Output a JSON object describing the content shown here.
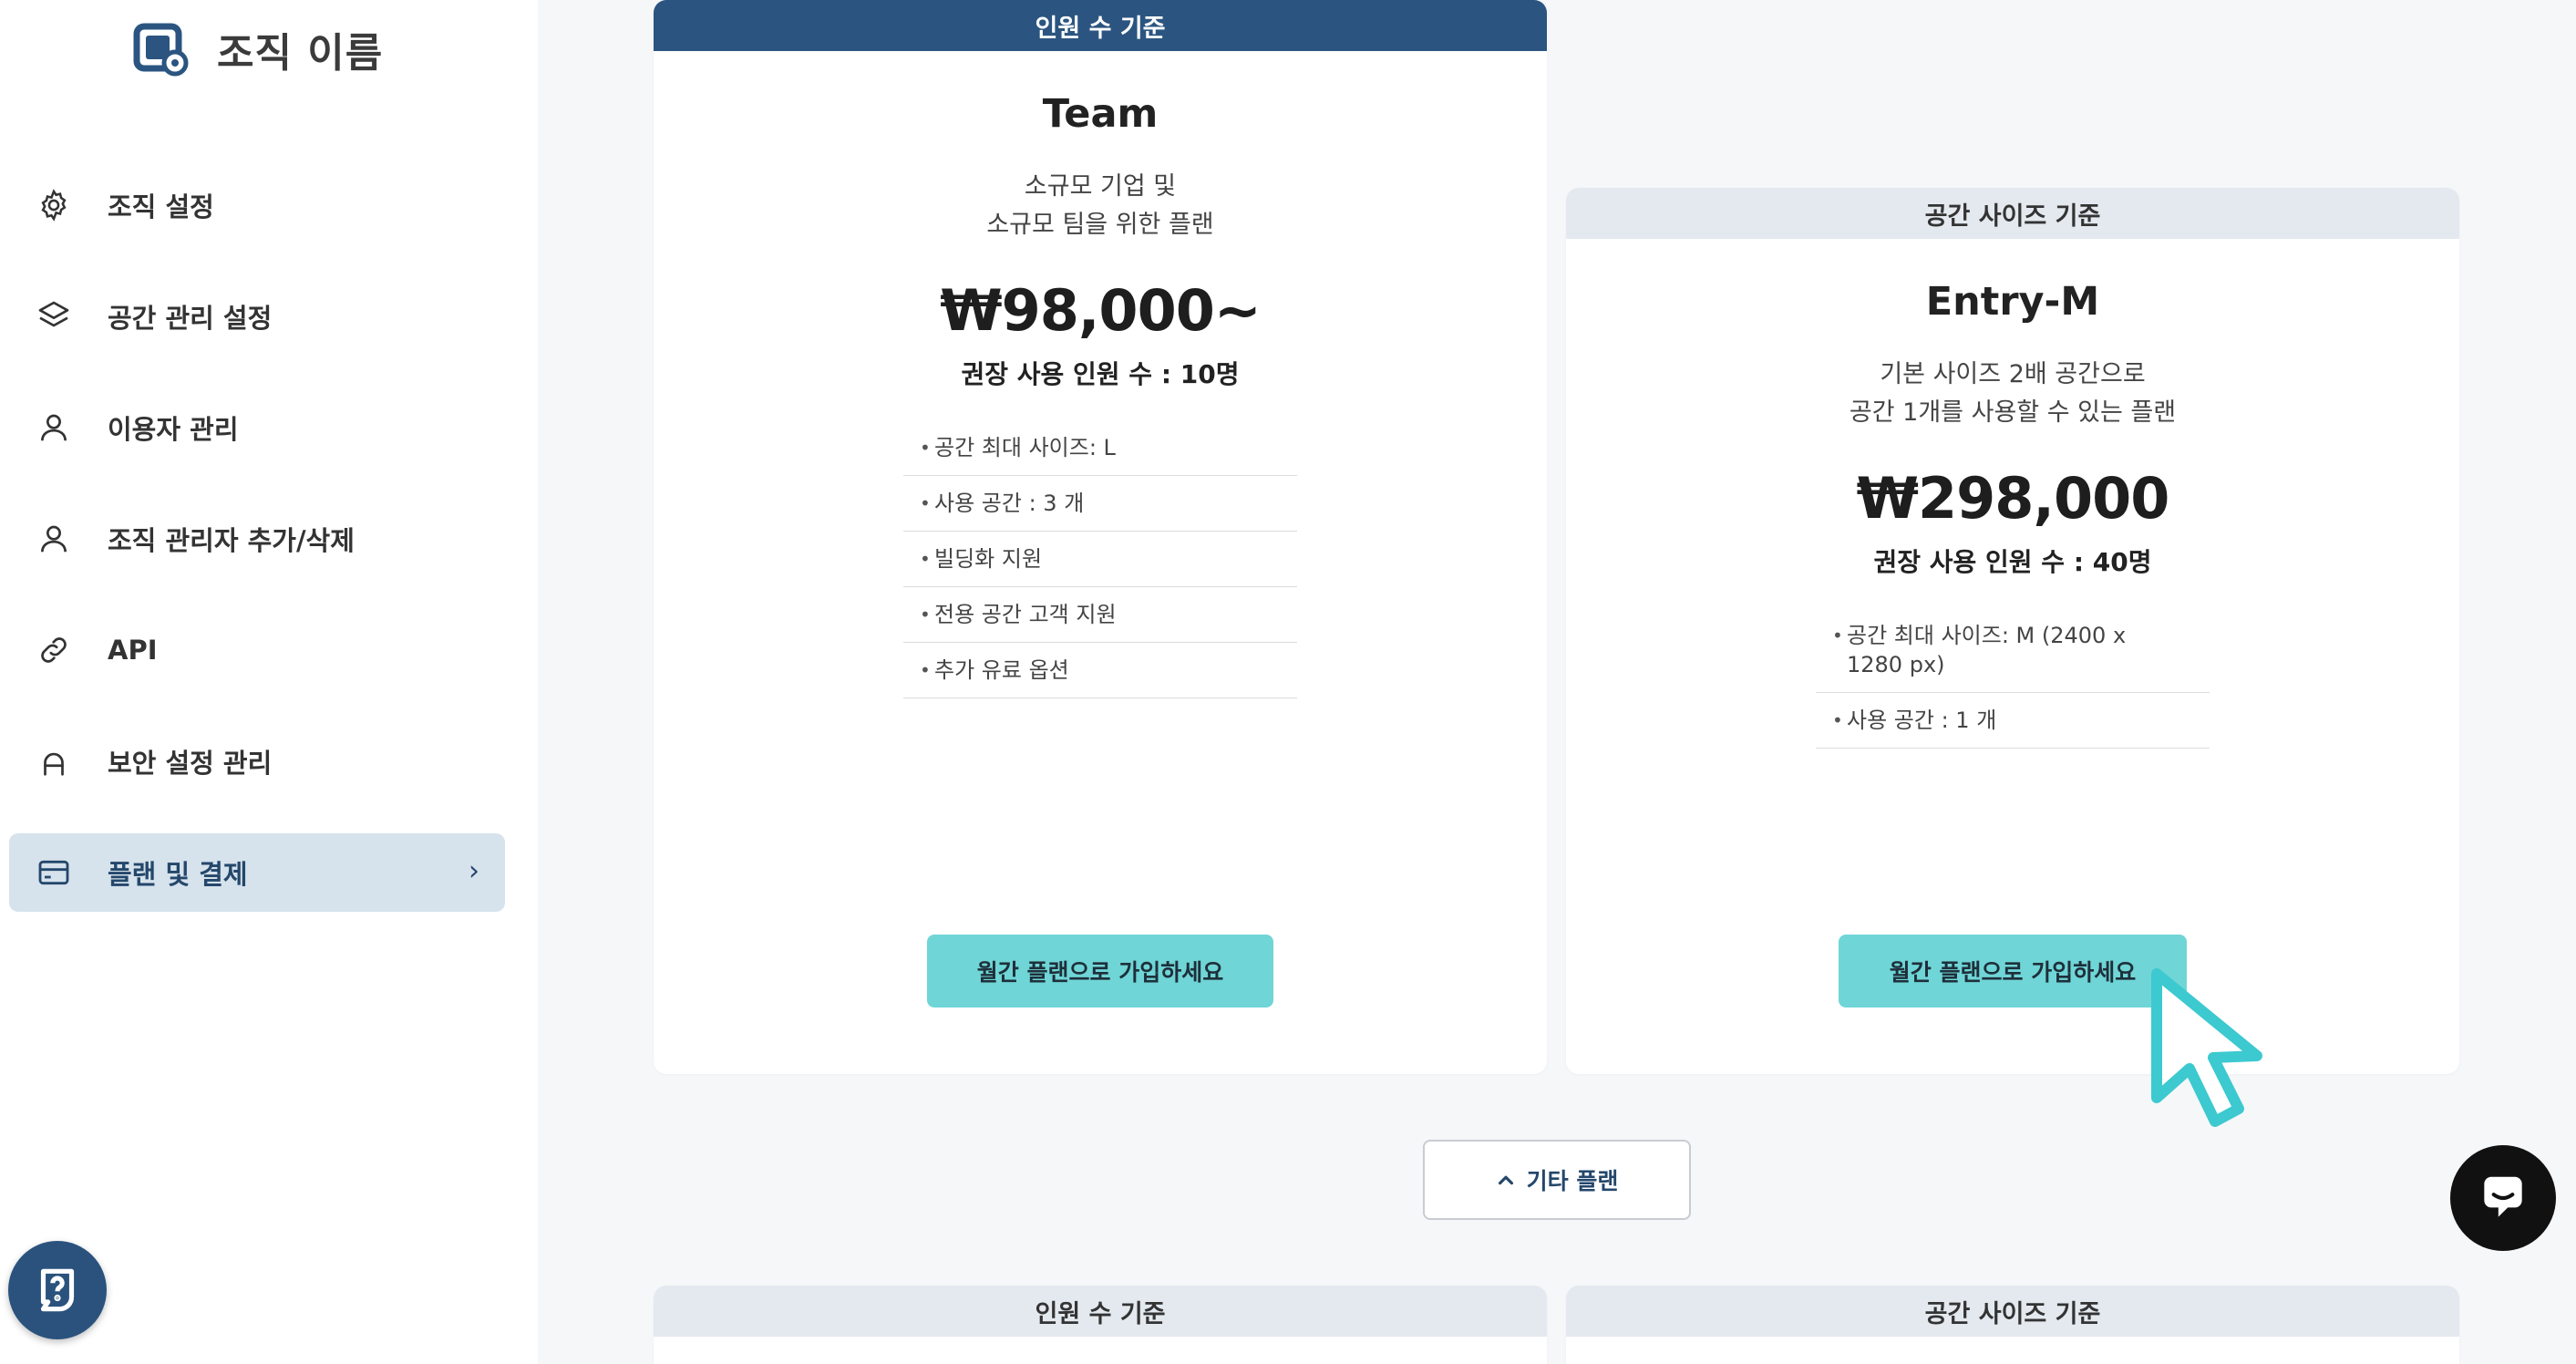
{
  "sidebar": {
    "org_name": "조직 이름",
    "items": [
      {
        "label": "조직 설정",
        "icon": "gear-icon"
      },
      {
        "label": "공간 관리 설정",
        "icon": "layers-icon"
      },
      {
        "label": "이용자 관리",
        "icon": "user-icon"
      },
      {
        "label": "조직 관리자 추가/삭제",
        "icon": "user-icon"
      },
      {
        "label": "API",
        "icon": "link-icon"
      },
      {
        "label": "보안 설정 관리",
        "icon": "lock-icon"
      },
      {
        "label": "플랜 및 결제",
        "icon": "credit-card-icon",
        "active": true,
        "chevron": "›"
      }
    ]
  },
  "plans": [
    {
      "header": "인원 수 기준",
      "name": "Team",
      "desc_line1": "소규모 기업 및",
      "desc_line2": "소규모 팀을 위한 플랜",
      "price": "₩98,000~",
      "recommended": "권장 사용 인원 수 : 10명",
      "features": [
        "공간 최대 사이즈: L",
        "사용 공간 :  3 개",
        "빌딩화 지원",
        "전용 공간 고객 지원",
        "추가 유료 옵션"
      ],
      "button": "월간 플랜으로 가입하세요"
    },
    {
      "header": "공간 사이즈 기준",
      "name": "Entry-M",
      "desc_line1": "기본 사이즈 2배 공간으로",
      "desc_line2": "공간 1개를 사용할 수 있는 플랜",
      "price": "₩298,000",
      "recommended": "권장 사용 인원 수 : 40명",
      "features": [
        "공간 최대 사이즈: M (2400 x 1280 px)",
        "사용 공간 :  1 개"
      ],
      "button": "월간 플랜으로 가입하세요"
    }
  ],
  "other_plans_label": "기타 플랜",
  "bottom_headers": [
    "인원 수 기준",
    "공간 사이즈 기준"
  ],
  "colors": {
    "primary_dark": "#2b5580",
    "accent_teal": "#6fd5d6",
    "active_nav_bg": "#d6e2ec"
  }
}
